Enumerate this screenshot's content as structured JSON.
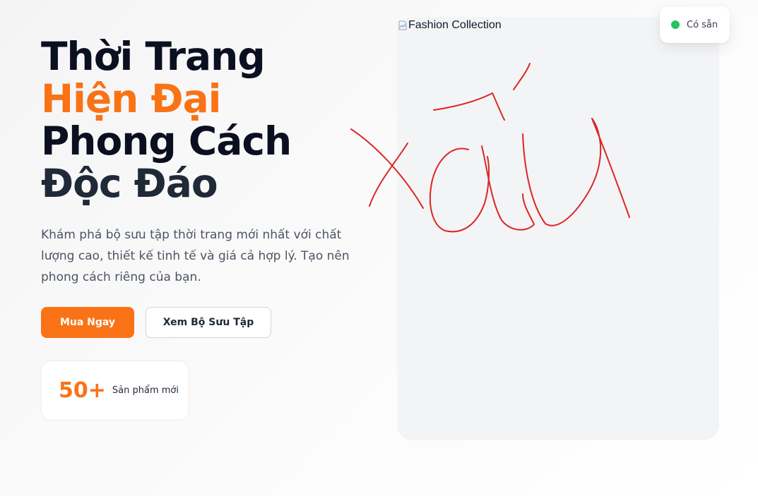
{
  "hero": {
    "headline": [
      "Thời Trang",
      "Hiện Đại",
      "Phong Cách",
      "Độc Đáo"
    ],
    "description": "Khám phá bộ sưu tập thời trang mới nhất với chất lượng cao, thiết kế tinh tế và giá cả hợp lý. Tạo nên phong cách riêng của bạn.",
    "primary_button": "Mua Ngay",
    "secondary_button": "Xem Bộ Sưu Tập",
    "stat": {
      "value": "50+",
      "label": "Sản phẩm mới"
    }
  },
  "image": {
    "alt_text": "Fashion Collection",
    "icon": "broken-image-icon"
  },
  "badge": {
    "label": "Có sẵn",
    "dot_color": "#22c55e"
  },
  "colors": {
    "accent": "#f97316",
    "scribble": "#dc2626"
  }
}
